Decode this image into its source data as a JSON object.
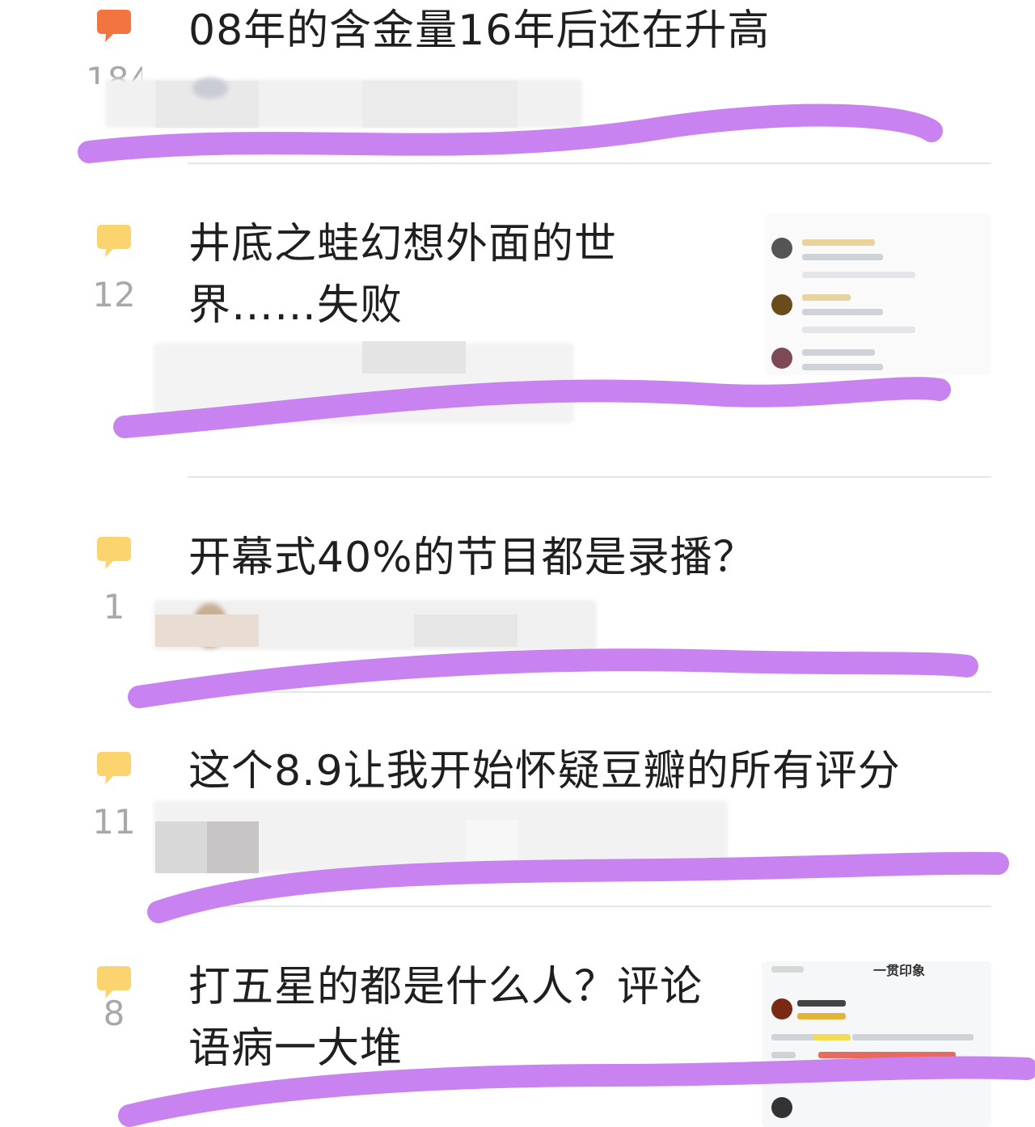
{
  "colors": {
    "bubble_hot": "#f2753f",
    "bubble_normal": "#fbd470",
    "scribble": "#c883f0"
  },
  "icons": {
    "reply_bubble": "speech-bubble-icon"
  },
  "topics": [
    {
      "title": "08年的含金量16年后还在升高",
      "count": "184",
      "hot": true
    },
    {
      "title": "井底之蛙幻想外面的世界……失败",
      "count": "12",
      "hot": false
    },
    {
      "title": "开幕式40%的节目都是录播？",
      "count": "1",
      "hot": false
    },
    {
      "title": "这个8.9让我开始怀疑豆瓣的所有评分",
      "count": "11",
      "hot": false
    },
    {
      "title": "打五星的都是什么人？评论语病一大堆",
      "count": "8",
      "hot": false
    }
  ],
  "thumbnails": {
    "review_header": "一贯印象"
  }
}
